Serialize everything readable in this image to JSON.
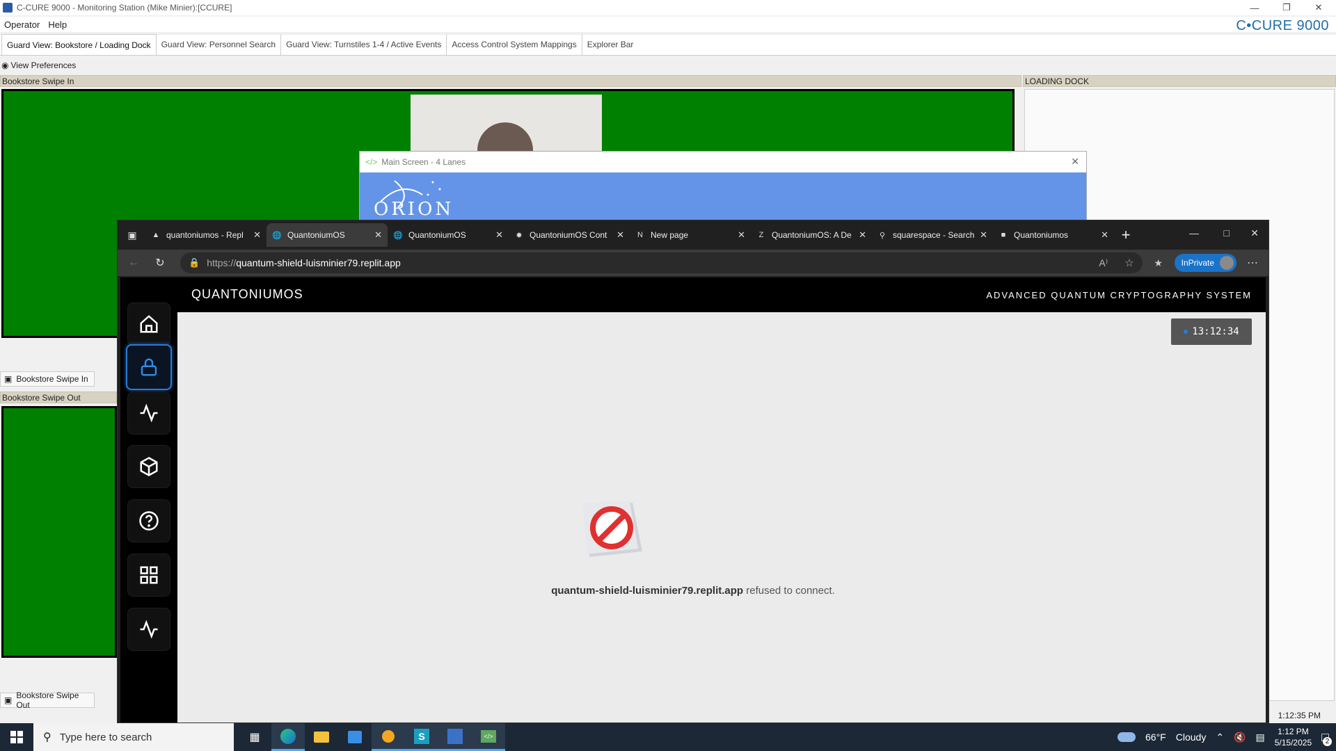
{
  "ccure": {
    "window_title": "C-CURE 9000 - Monitoring Station (Mike Minier):[CCURE]",
    "brand": "C•CURE 9000",
    "menu": [
      "Operator",
      "Help"
    ],
    "tabs": [
      "Guard View: Bookstore / Loading Dock",
      "Guard View: Personnel Search",
      "Guard View: Turnstiles 1-4 / Active Events",
      "Access Control System Mappings",
      "Explorer Bar"
    ],
    "view_preferences": "View Preferences",
    "panel_swipe_in": "Bookstore Swipe In",
    "panel_swipe_out": "Bookstore Swipe Out",
    "panel_loading_dock": "LOADING DOCK",
    "cam_tab_in": "Bookstore Swipe In",
    "cam_tab_out": "Bookstore Swipe Out",
    "status_time": "1:12:35 PM"
  },
  "popup": {
    "title": "Main Screen - 4 Lanes",
    "logo_text": "ORION"
  },
  "browser": {
    "tabs": [
      {
        "title": "quantoniumos - Repl",
        "icon": "replit-icon"
      },
      {
        "title": "QuantoniumOS",
        "icon": "globe-icon"
      },
      {
        "title": "QuantoniumOS",
        "icon": "globe-icon"
      },
      {
        "title": "QuantoniumOS Cont",
        "icon": "openai-icon"
      },
      {
        "title": "New page",
        "icon": "notion-icon"
      },
      {
        "title": "QuantoniumOS: A De",
        "icon": "zenodo-icon"
      },
      {
        "title": "squarespace - Search",
        "icon": "search-icon"
      },
      {
        "title": "Quantoniumos",
        "icon": "app-icon"
      }
    ],
    "active_tab": 1,
    "url_proto": "https://",
    "url_host": "quantum-shield-luisminier79.replit.app",
    "inprivate": "InPrivate"
  },
  "page": {
    "logo": "QUANTONIUMOS",
    "subtitle": "ADVANCED QUANTUM CRYPTOGRAPHY SYSTEM",
    "clock": "13:12:34",
    "error_host": "quantum-shield-luisminier79.replit.app",
    "error_msg": " refused to connect.",
    "sidebar": [
      "home-icon",
      "lock-icon",
      "activity-icon",
      "cube-icon",
      "help-icon",
      "grid-icon",
      "activity-icon"
    ],
    "active_sidebar": 1
  },
  "taskbar": {
    "search_placeholder": "Type here to search",
    "weather_temp": "66°F",
    "weather_desc": "Cloudy",
    "time": "1:12 PM",
    "date": "5/15/2025",
    "notif_count": "2"
  }
}
